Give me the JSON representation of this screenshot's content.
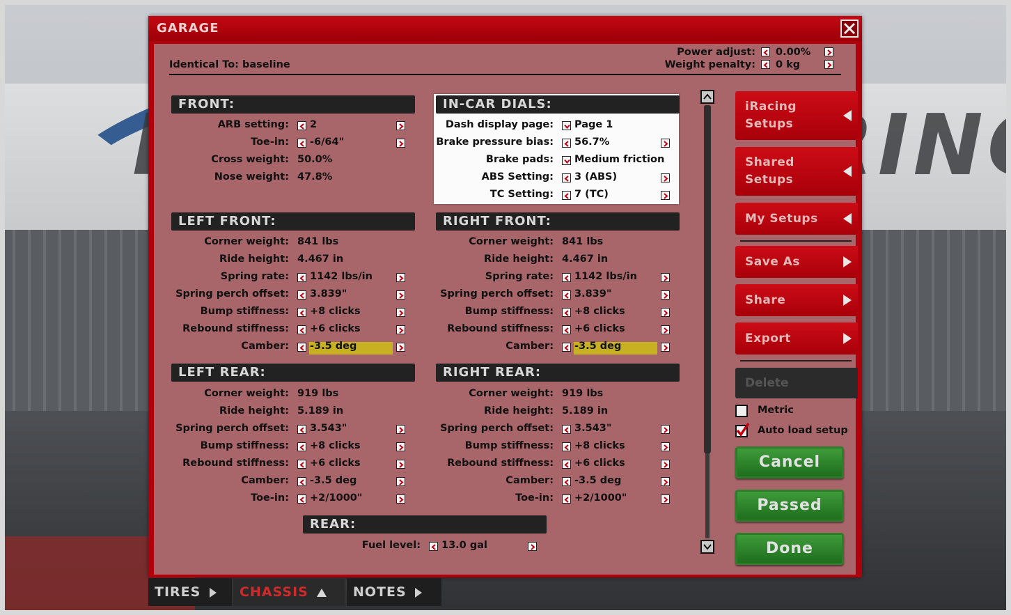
{
  "window": {
    "title": "GARAGE"
  },
  "header": {
    "identical_to": "Identical To: baseline",
    "power_adjust_label": "Power adjust:",
    "power_adjust_value": "0.00%",
    "weight_penalty_label": "Weight penalty:",
    "weight_penalty_value": "0 kg"
  },
  "front": {
    "title": "FRONT:",
    "rows": [
      {
        "label": "ARB setting:",
        "value": "2"
      },
      {
        "label": "Toe-in:",
        "value": "-6/64\""
      },
      {
        "label": "Cross weight:",
        "value": "50.0%"
      },
      {
        "label": "Nose weight:",
        "value": "47.8%"
      }
    ]
  },
  "dials": {
    "title": "IN-CAR DIALS:",
    "rows": [
      {
        "label": "Dash display page:",
        "value": "Page 1"
      },
      {
        "label": "Brake pressure bias:",
        "value": "56.7%"
      },
      {
        "label": "Brake pads:",
        "value": "Medium friction"
      },
      {
        "label": "ABS Setting:",
        "value": "3 (ABS)"
      },
      {
        "label": "TC Setting:",
        "value": "7 (TC)"
      }
    ]
  },
  "left_front": {
    "title": "LEFT FRONT:",
    "rows": [
      {
        "label": "Corner weight:",
        "value": "841 lbs"
      },
      {
        "label": "Ride height:",
        "value": "4.467 in"
      },
      {
        "label": "Spring rate:",
        "value": "1142 lbs/in"
      },
      {
        "label": "Spring perch offset:",
        "value": "3.839\""
      },
      {
        "label": "Bump stiffness:",
        "value": "+8 clicks"
      },
      {
        "label": "Rebound stiffness:",
        "value": "+6 clicks"
      },
      {
        "label": "Camber:",
        "value": "-3.5 deg"
      }
    ]
  },
  "right_front": {
    "title": "RIGHT FRONT:",
    "rows": [
      {
        "label": "Corner weight:",
        "value": "841 lbs"
      },
      {
        "label": "Ride height:",
        "value": "4.467 in"
      },
      {
        "label": "Spring rate:",
        "value": "1142 lbs/in"
      },
      {
        "label": "Spring perch offset:",
        "value": "3.839\""
      },
      {
        "label": "Bump stiffness:",
        "value": "+8 clicks"
      },
      {
        "label": "Rebound stiffness:",
        "value": "+6 clicks"
      },
      {
        "label": "Camber:",
        "value": "-3.5 deg"
      }
    ]
  },
  "left_rear": {
    "title": "LEFT REAR:",
    "rows": [
      {
        "label": "Corner weight:",
        "value": "919 lbs"
      },
      {
        "label": "Ride height:",
        "value": "5.189 in"
      },
      {
        "label": "Spring perch offset:",
        "value": "3.543\""
      },
      {
        "label": "Bump stiffness:",
        "value": "+8 clicks"
      },
      {
        "label": "Rebound stiffness:",
        "value": "+6 clicks"
      },
      {
        "label": "Camber:",
        "value": "-3.5 deg"
      },
      {
        "label": "Toe-in:",
        "value": "+2/1000\""
      }
    ]
  },
  "right_rear": {
    "title": "RIGHT REAR:",
    "rows": [
      {
        "label": "Corner weight:",
        "value": "919 lbs"
      },
      {
        "label": "Ride height:",
        "value": "5.189 in"
      },
      {
        "label": "Spring perch offset:",
        "value": "3.543\""
      },
      {
        "label": "Bump stiffness:",
        "value": "+8 clicks"
      },
      {
        "label": "Rebound stiffness:",
        "value": "+6 clicks"
      },
      {
        "label": "Camber:",
        "value": "-3.5 deg"
      },
      {
        "label": "Toe-in:",
        "value": "+2/1000\""
      }
    ]
  },
  "rear": {
    "title": "REAR:",
    "fuel_label": "Fuel level:",
    "fuel_value": "13.0 gal"
  },
  "sidebar": {
    "iracing_setups_l1": "iRacing",
    "iracing_setups_l2": "Setups",
    "shared_setups_l1": "Shared",
    "shared_setups_l2": "Setups",
    "my_setups": "My Setups",
    "save_as": "Save As",
    "share": "Share",
    "export": "Export",
    "delete": "Delete",
    "metric": "Metric",
    "auto_load": "Auto load setup",
    "cancel": "Cancel",
    "passed": "Passed",
    "done": "Done"
  },
  "tabs": {
    "tires": "TIRES",
    "chassis": "CHASSIS",
    "notes": "NOTES"
  },
  "background": {
    "track_text": "HOCKENHEIMRING"
  },
  "colors": {
    "window_red": "#b0000c",
    "highlight": "#c7b122",
    "green": "#2d7d2a"
  }
}
